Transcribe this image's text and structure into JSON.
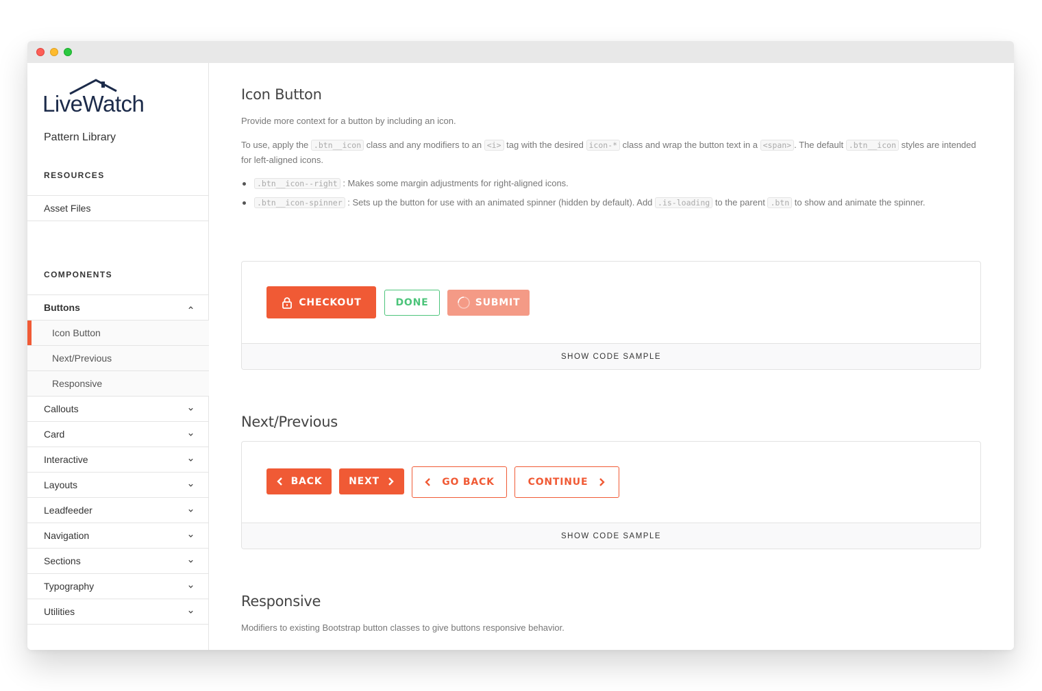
{
  "brand": {
    "logo_text": "LiveWatch",
    "library_title": "Pattern Library"
  },
  "sidebar": {
    "resources_label": "RESOURCES",
    "resources": [
      {
        "label": "Asset Files"
      }
    ],
    "components_label": "COMPONENTS",
    "components": {
      "buttons": {
        "label": "Buttons",
        "children": [
          "Icon Button",
          "Next/Previous",
          "Responsive"
        ]
      },
      "others": [
        "Callouts",
        "Card",
        "Interactive",
        "Layouts",
        "Leadfeeder",
        "Navigation",
        "Sections",
        "Typography",
        "Utilities"
      ]
    }
  },
  "icon_button": {
    "title": "Icon Button",
    "intro": "Provide more context for a button by including an icon.",
    "usage": {
      "t1": "To use, apply the ",
      "c1": ".btn__icon",
      "t2": " class and any modifiers to an ",
      "c2": "<i>",
      "t3": " tag with the desired ",
      "c3": "icon-*",
      "t4": " class and wrap the button text in a ",
      "c4": "<span>",
      "t5": ". The default ",
      "c5": ".btn__icon",
      "t6": " styles are intended for left-aligned icons."
    },
    "bullet1": {
      "code": ".btn__icon--right",
      "text": " : Makes some margin adjustments for right-aligned icons."
    },
    "bullet2": {
      "code": ".btn__icon-spinner",
      "t1": " : Sets up the button for use with an animated spinner (hidden by default). Add ",
      "c2": ".is-loading",
      "t2": " to the parent ",
      "c3": ".btn",
      "t3": " to show and animate the spinner."
    },
    "buttons": {
      "checkout": "CHECKOUT",
      "done": "DONE",
      "submit": "SUBMIT"
    },
    "show_code": "SHOW CODE SAMPLE"
  },
  "next_previous": {
    "title": "Next/Previous",
    "buttons": {
      "back": "BACK",
      "next": "NEXT",
      "go_back": "GO BACK",
      "continue": "CONTINUE"
    },
    "show_code": "SHOW CODE SAMPLE"
  },
  "responsive": {
    "title": "Responsive",
    "intro": "Modifiers to existing Bootstrap button classes to give buttons responsive behavior."
  },
  "colors": {
    "accent": "#f05a35",
    "success": "#4cc47a",
    "loading": "#f49a86",
    "logo": "#1c2b4a"
  },
  "icons": [
    "lock-icon",
    "spinner-icon",
    "chevron-left-icon",
    "chevron-right-icon",
    "chevron-up-icon",
    "chevron-down-icon"
  ]
}
